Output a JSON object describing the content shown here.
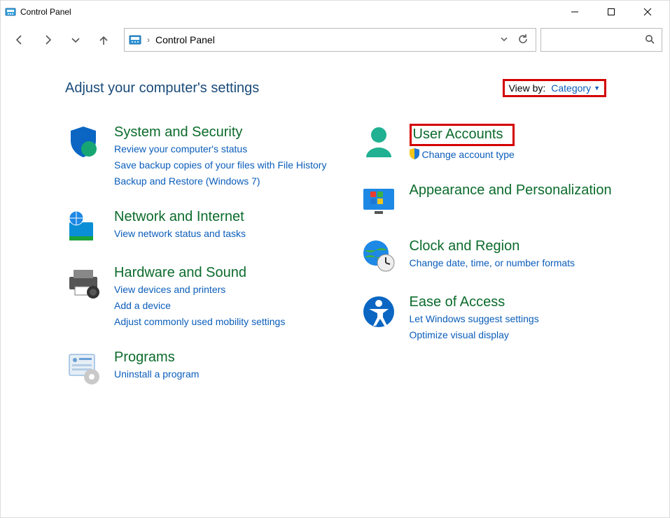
{
  "window": {
    "title": "Control Panel"
  },
  "address": {
    "location": "Control Panel"
  },
  "heading": "Adjust your computer's settings",
  "viewby": {
    "label": "View by:",
    "value": "Category"
  },
  "left": {
    "system": {
      "title": "System and Security",
      "l1": "Review your computer's status",
      "l2": "Save backup copies of your files with File History",
      "l3": "Backup and Restore (Windows 7)"
    },
    "network": {
      "title": "Network and Internet",
      "l1": "View network status and tasks"
    },
    "hardware": {
      "title": "Hardware and Sound",
      "l1": "View devices and printers",
      "l2": "Add a device",
      "l3": "Adjust commonly used mobility settings"
    },
    "programs": {
      "title": "Programs",
      "l1": "Uninstall a program"
    }
  },
  "right": {
    "users": {
      "title": "User Accounts",
      "l1": "Change account type"
    },
    "appearance": {
      "title": "Appearance and Personalization"
    },
    "clock": {
      "title": "Clock and Region",
      "l1": "Change date, time, or number formats"
    },
    "ease": {
      "title": "Ease of Access",
      "l1": "Let Windows suggest settings",
      "l2": "Optimize visual display"
    }
  }
}
